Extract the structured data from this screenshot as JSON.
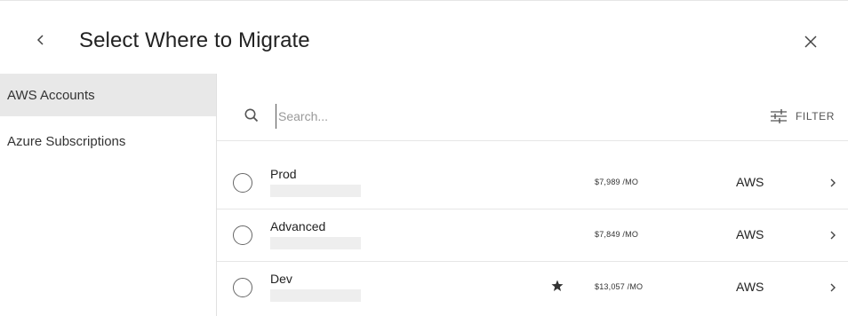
{
  "header": {
    "title": "Select Where to Migrate",
    "back_icon": "chevron-left-icon",
    "close_icon": "close-icon"
  },
  "sidebar": {
    "items": [
      {
        "label": "AWS Accounts",
        "active": true
      },
      {
        "label": "Azure Subscriptions",
        "active": false
      }
    ]
  },
  "search": {
    "placeholder": "Search...",
    "value": ""
  },
  "filter": {
    "label": "FILTER",
    "icon": "sliders-icon"
  },
  "accounts": [
    {
      "name": "Prod",
      "starred": false,
      "price": "$7,989 /MO",
      "provider": "AWS"
    },
    {
      "name": "Advanced",
      "starred": false,
      "price": "$7,849 /MO",
      "provider": "AWS"
    },
    {
      "name": "Dev",
      "starred": true,
      "price": "$13,057 /MO",
      "provider": "AWS"
    }
  ],
  "colors": {
    "active_sidebar_bg": "#e8e8e8",
    "divider": "#e6e6e6",
    "text": "#222222"
  }
}
